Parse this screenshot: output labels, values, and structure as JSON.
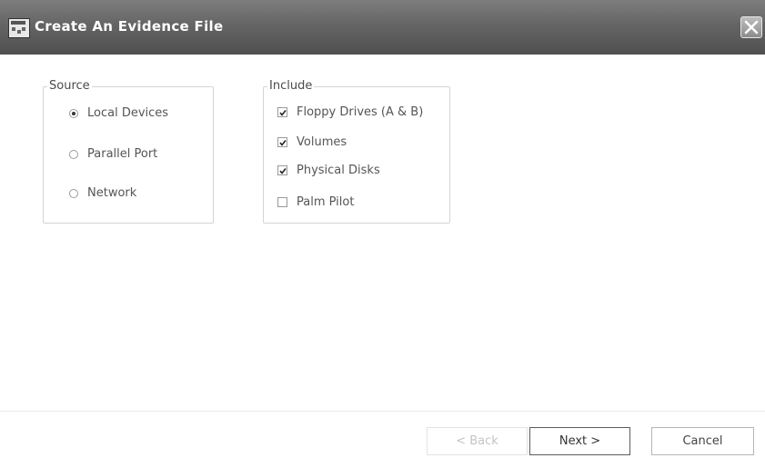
{
  "window": {
    "title": "Create An Evidence File",
    "app_icon": "encase-app-icon",
    "close_icon": "close-icon"
  },
  "source": {
    "legend": "Source",
    "options": [
      {
        "label": "Local Devices",
        "selected": true
      },
      {
        "label": "Parallel Port",
        "selected": false
      },
      {
        "label": "Network",
        "selected": false
      }
    ]
  },
  "include": {
    "legend": "Include",
    "options": [
      {
        "label": "Floppy Drives (A & B)",
        "checked": true
      },
      {
        "label": "Volumes",
        "checked": true
      },
      {
        "label": "Physical Disks",
        "checked": true
      },
      {
        "label": "Palm Pilot",
        "checked": false
      }
    ]
  },
  "buttons": {
    "back": {
      "label": "< Back",
      "enabled": false
    },
    "next": {
      "label": "Next >",
      "enabled": true
    },
    "cancel": {
      "label": "Cancel",
      "enabled": true
    }
  },
  "colors": {
    "titlebar": "#656565",
    "title_text": "#ffffff",
    "disabled_text": "#c4c4c4"
  }
}
